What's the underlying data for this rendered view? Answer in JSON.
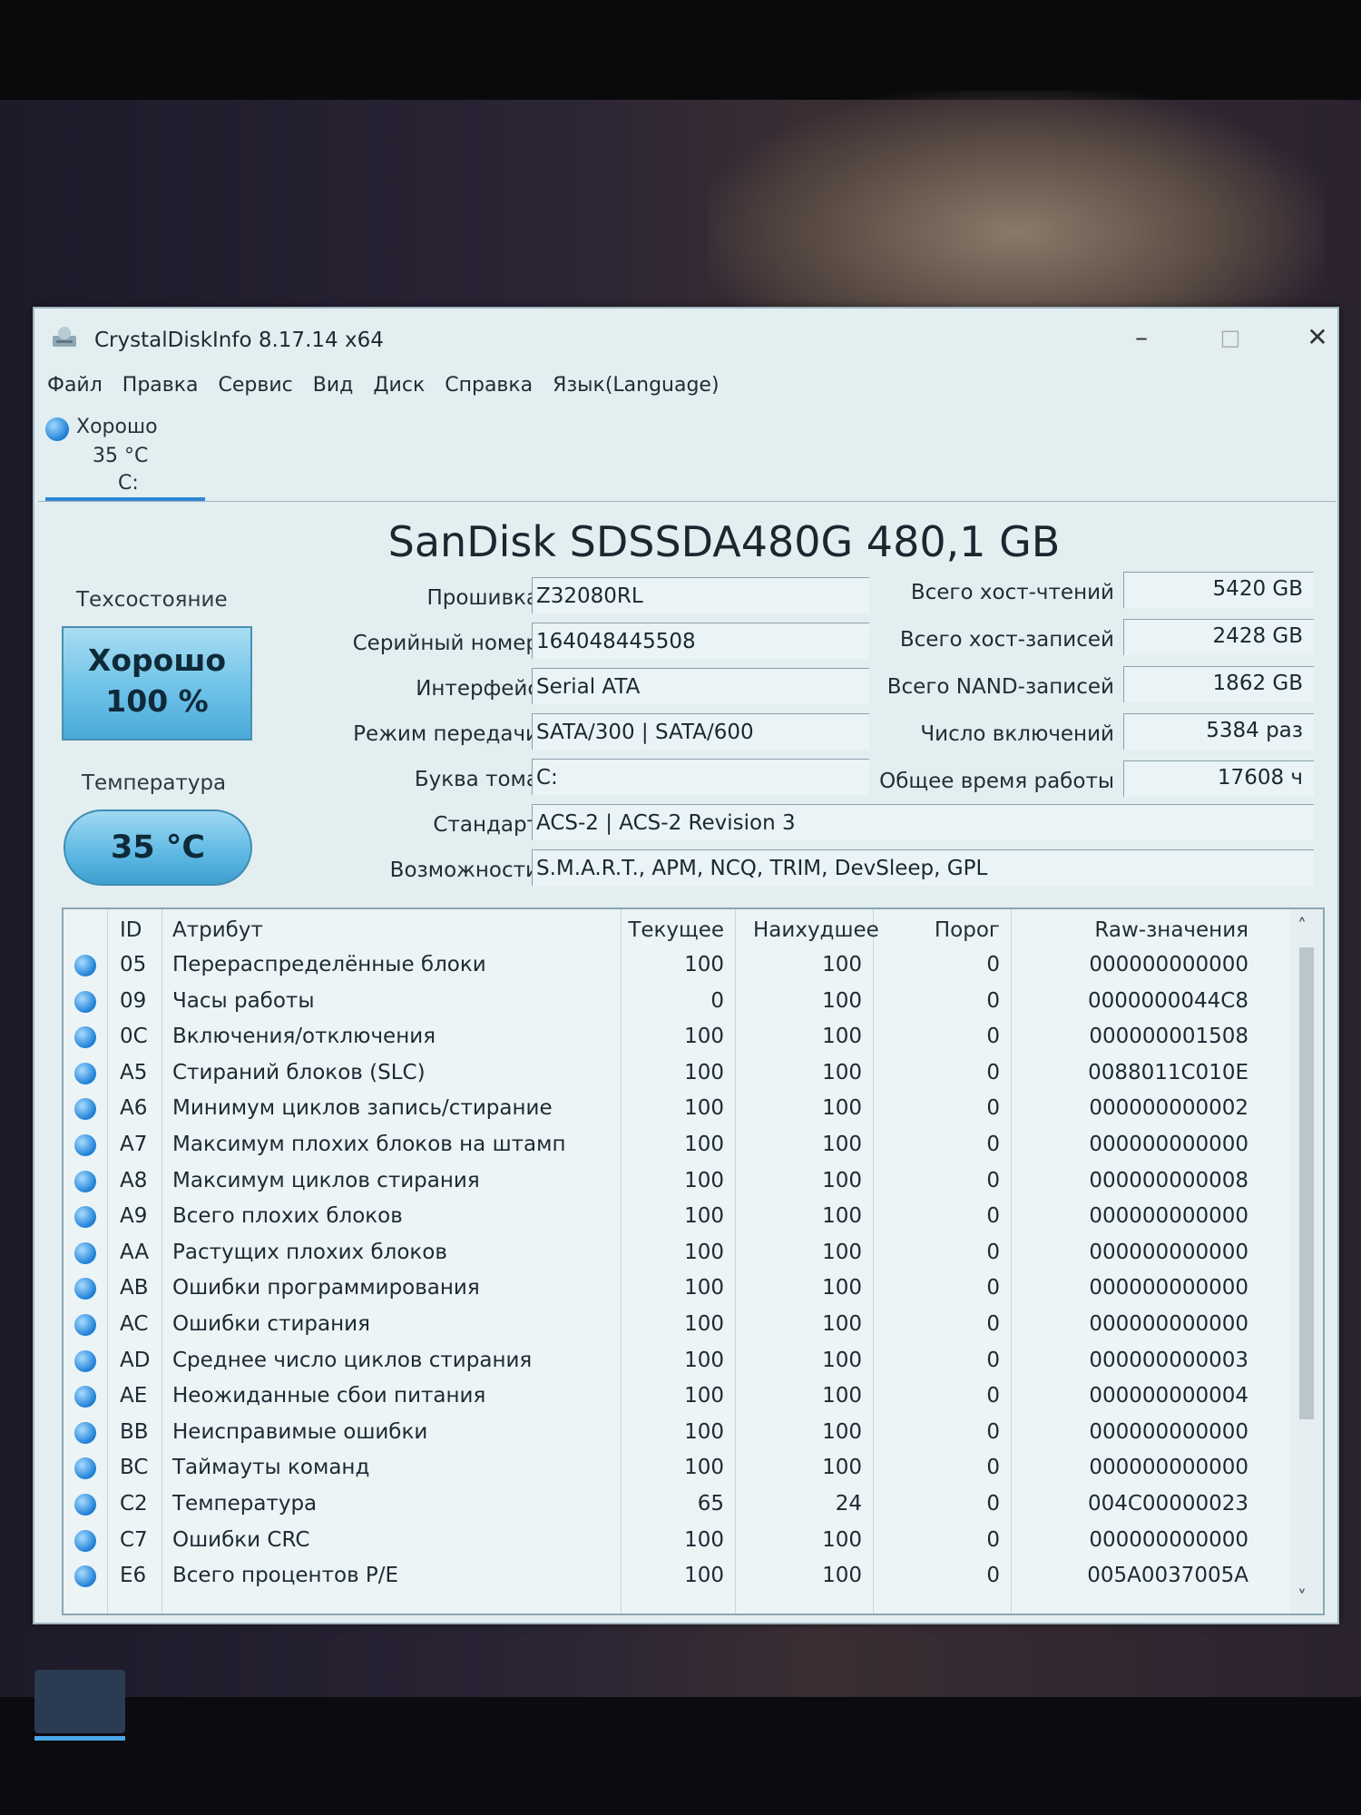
{
  "window": {
    "title": "CrystalDiskInfo 8.17.14 x64"
  },
  "menu": [
    "Файл",
    "Правка",
    "Сервис",
    "Вид",
    "Диск",
    "Справка",
    "Язык(Language)"
  ],
  "drive_tab": {
    "status": "Хорошо",
    "temp": "35 °C",
    "letter": "C:"
  },
  "disk": {
    "title": "SanDisk SDSSDA480G 480,1 GB"
  },
  "health": {
    "label": "Техсостояние",
    "status": "Хорошо",
    "percent": "100 %",
    "temp_label": "Температура",
    "temp": "35 °C"
  },
  "info": [
    {
      "label": "Прошивка",
      "value": "Z32080RL"
    },
    {
      "label": "Серийный номер",
      "value": "164048445508"
    },
    {
      "label": "Интерфейс",
      "value": "Serial ATA"
    },
    {
      "label": "Режим передачи",
      "value": "SATA/300 | SATA/600"
    },
    {
      "label": "Буква тома",
      "value": "C:"
    },
    {
      "label": "Стандарт",
      "value": "ACS-2 | ACS-2 Revision 3"
    },
    {
      "label": "Возможности",
      "value": "S.M.A.R.T., APM, NCQ, TRIM, DevSleep, GPL"
    }
  ],
  "stats": [
    {
      "label": "Всего хост-чтений",
      "value": "5420 GB"
    },
    {
      "label": "Всего хост-записей",
      "value": "2428 GB"
    },
    {
      "label": "Всего NAND-записей",
      "value": "1862 GB"
    },
    {
      "label": "Число включений",
      "value": "5384 раз"
    },
    {
      "label": "Общее время работы",
      "value": "17608 ч"
    }
  ],
  "smart": {
    "headers": {
      "id": "ID",
      "attr": "Атрибут",
      "cur": "Текущее",
      "worst": "Наихудшее",
      "thr": "Порог",
      "raw": "Raw-значения"
    },
    "rows": [
      {
        "id": "05",
        "attr": "Перераспределённые блоки",
        "cur": "100",
        "worst": "100",
        "thr": "0",
        "raw": "000000000000"
      },
      {
        "id": "09",
        "attr": "Часы работы",
        "cur": "0",
        "worst": "100",
        "thr": "0",
        "raw": "0000000044C8"
      },
      {
        "id": "0C",
        "attr": "Включения/отключения",
        "cur": "100",
        "worst": "100",
        "thr": "0",
        "raw": "000000001508"
      },
      {
        "id": "A5",
        "attr": "Стираний блоков (SLC)",
        "cur": "100",
        "worst": "100",
        "thr": "0",
        "raw": "0088011C010E"
      },
      {
        "id": "A6",
        "attr": "Минимум циклов запись/стирание",
        "cur": "100",
        "worst": "100",
        "thr": "0",
        "raw": "000000000002"
      },
      {
        "id": "A7",
        "attr": "Максимум плохих блоков на штамп",
        "cur": "100",
        "worst": "100",
        "thr": "0",
        "raw": "000000000000"
      },
      {
        "id": "A8",
        "attr": "Максимум циклов стирания",
        "cur": "100",
        "worst": "100",
        "thr": "0",
        "raw": "000000000008"
      },
      {
        "id": "A9",
        "attr": "Всего плохих блоков",
        "cur": "100",
        "worst": "100",
        "thr": "0",
        "raw": "000000000000"
      },
      {
        "id": "AA",
        "attr": "Растущих плохих блоков",
        "cur": "100",
        "worst": "100",
        "thr": "0",
        "raw": "000000000000"
      },
      {
        "id": "AB",
        "attr": "Ошибки программирования",
        "cur": "100",
        "worst": "100",
        "thr": "0",
        "raw": "000000000000"
      },
      {
        "id": "AC",
        "attr": "Ошибки стирания",
        "cur": "100",
        "worst": "100",
        "thr": "0",
        "raw": "000000000000"
      },
      {
        "id": "AD",
        "attr": "Среднее число циклов стирания",
        "cur": "100",
        "worst": "100",
        "thr": "0",
        "raw": "000000000003"
      },
      {
        "id": "AE",
        "attr": "Неожиданные сбои питания",
        "cur": "100",
        "worst": "100",
        "thr": "0",
        "raw": "000000000004"
      },
      {
        "id": "BB",
        "attr": "Неисправимые ошибки",
        "cur": "100",
        "worst": "100",
        "thr": "0",
        "raw": "000000000000"
      },
      {
        "id": "BC",
        "attr": "Таймауты команд",
        "cur": "100",
        "worst": "100",
        "thr": "0",
        "raw": "000000000000"
      },
      {
        "id": "C2",
        "attr": "Температура",
        "cur": "65",
        "worst": "24",
        "thr": "0",
        "raw": "004C00000023"
      },
      {
        "id": "C7",
        "attr": "Ошибки CRC",
        "cur": "100",
        "worst": "100",
        "thr": "0",
        "raw": "000000000000"
      },
      {
        "id": "E6",
        "attr": "Всего процентов P/E",
        "cur": "100",
        "worst": "100",
        "thr": "0",
        "raw": "005A0037005A"
      }
    ]
  }
}
